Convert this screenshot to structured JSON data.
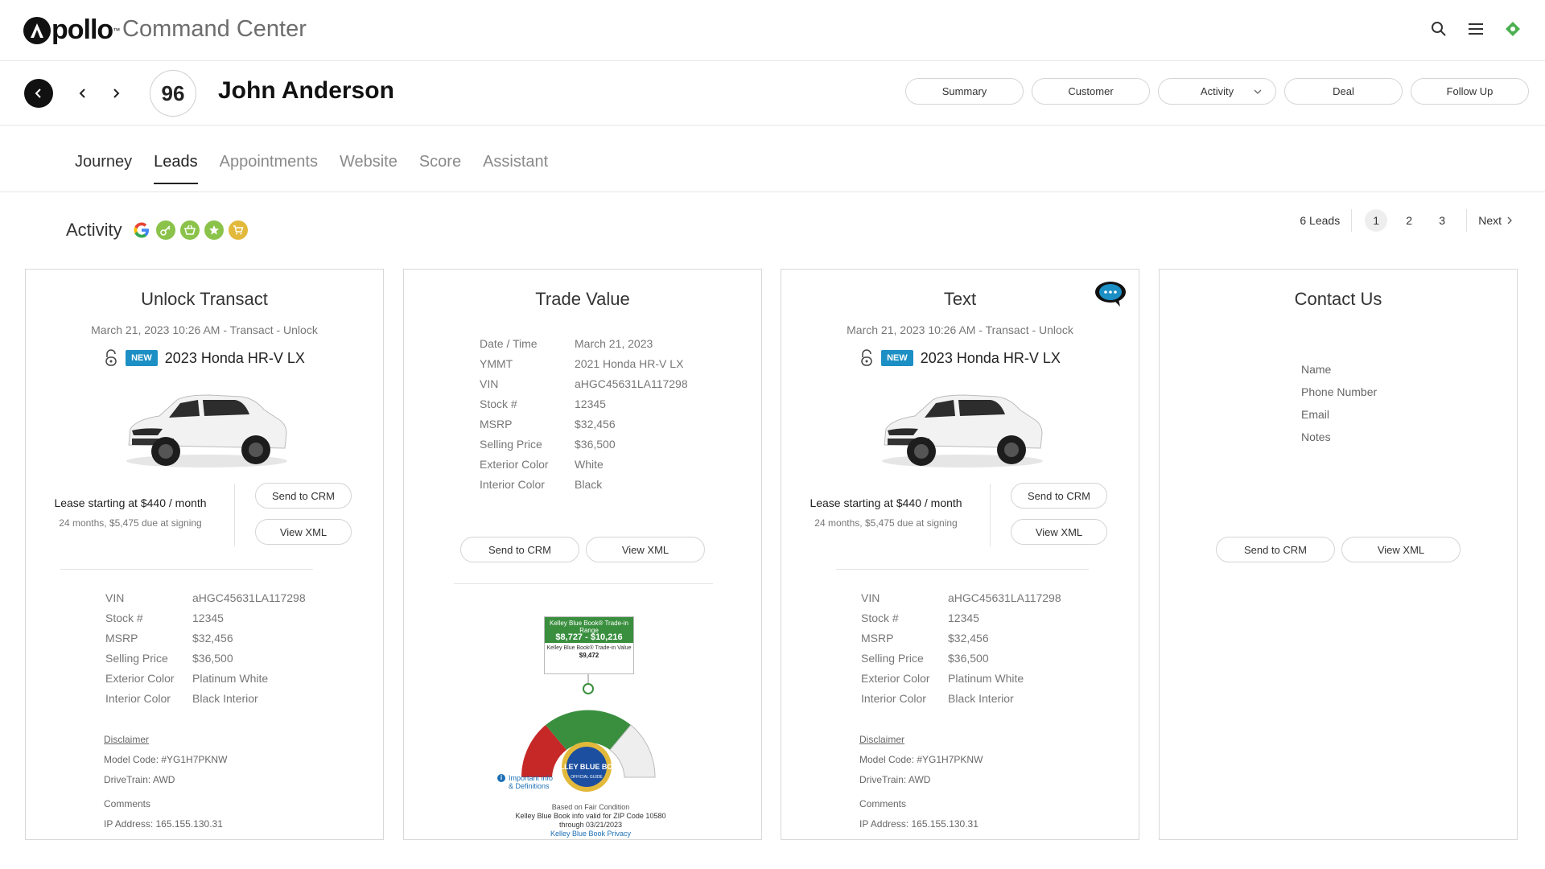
{
  "app": {
    "logo_text": "pollo",
    "logo_tm": "™",
    "title": "Command Center",
    "colors": {
      "accent_green": "#4caf50",
      "new_badge": "#1c8fc4",
      "kbb_green": "#3a8f3f",
      "kbb_red": "#c62828"
    }
  },
  "header": {
    "score": "96",
    "customer_name": "John Anderson",
    "pills": [
      {
        "label": "Summary"
      },
      {
        "label": "Customer"
      },
      {
        "label": "Activity"
      },
      {
        "label": "Deal"
      },
      {
        "label": "Follow Up"
      }
    ]
  },
  "tabs": [
    {
      "label": "Journey"
    },
    {
      "label": "Leads"
    },
    {
      "label": "Appointments"
    },
    {
      "label": "Website"
    },
    {
      "label": "Score"
    },
    {
      "label": "Assistant"
    }
  ],
  "activity": {
    "label": "Activity",
    "icons": [
      "google-icon",
      "key-icon",
      "basket-icon",
      "star-icon",
      "cart-icon"
    ]
  },
  "pager": {
    "count": "6 Leads",
    "pages": [
      "1",
      "2",
      "3"
    ],
    "next": "Next"
  },
  "cards": {
    "unlock": {
      "title": "Unlock Transact",
      "subtitle": "March 21, 2023 10:26 AM - Transact - Unlock",
      "badge": "NEW",
      "vehicle": "2023 Honda HR-V LX",
      "lease_main": "Lease starting at $440 / month",
      "lease_sub": "24 months, $5,475 due at signing",
      "send_label": "Send to CRM",
      "xml_label": "View XML",
      "specs": [
        {
          "k": "VIN",
          "v": "aHGC45631LA117298"
        },
        {
          "k": "Stock #",
          "v": "12345"
        },
        {
          "k": "MSRP",
          "v": "$32,456"
        },
        {
          "k": "Selling Price",
          "v": "$36,500"
        },
        {
          "k": "Exterior Color",
          "v": "Platinum White"
        },
        {
          "k": "Interior Color",
          "v": "Black Interior"
        }
      ],
      "disclaimer": "Disclaimer",
      "model_code": "Model Code: #YG1H7PKNW",
      "drivetrain": "DriveTrain: AWD",
      "comments": "Comments",
      "ip": "IP Address: 165.155.130.31"
    },
    "trade": {
      "title": "Trade Value",
      "specs": [
        {
          "k": "Date / Time",
          "v": "March 21, 2023"
        },
        {
          "k": "YMMT",
          "v": "2021 Honda HR-V LX"
        },
        {
          "k": "VIN",
          "v": "aHGC45631LA117298"
        },
        {
          "k": "Stock #",
          "v": "12345"
        },
        {
          "k": "MSRP",
          "v": "$32,456"
        },
        {
          "k": "Selling Price",
          "v": "$36,500"
        },
        {
          "k": "Exterior Color",
          "v": "White"
        },
        {
          "k": "Interior Color",
          "v": "Black"
        }
      ],
      "send_label": "Send to CRM",
      "xml_label": "View XML",
      "kbb": {
        "header": "Kelley Blue Book® Trade-in Range",
        "range": "$8,727 - $10,216",
        "value_label": "Kelley Blue Book® Trade-in Value",
        "value": "$9,472",
        "seal_text": "KELLEY BLUE BOOK",
        "seal_sub": "OFFICIAL GUIDE",
        "info": "Important info & Definitions",
        "condition": "Based on Fair Condition",
        "zip_note": "Kelley Blue Book info valid for ZIP Code 10580",
        "through": "through 03/21/2023",
        "privacy": "Kelley Blue Book Privacy"
      }
    },
    "text": {
      "title": "Text",
      "subtitle": "March 21, 2023 10:26 AM - Transact - Unlock",
      "badge": "NEW",
      "vehicle": "2023 Honda HR-V LX",
      "lease_main": "Lease starting at $440 / month",
      "lease_sub": "24 months, $5,475 due at signing",
      "send_label": "Send to CRM",
      "xml_label": "View XML",
      "specs": [
        {
          "k": "VIN",
          "v": "aHGC45631LA117298"
        },
        {
          "k": "Stock #",
          "v": "12345"
        },
        {
          "k": "MSRP",
          "v": "$32,456"
        },
        {
          "k": "Selling Price",
          "v": "$36,500"
        },
        {
          "k": "Exterior Color",
          "v": "Platinum White"
        },
        {
          "k": "Interior Color",
          "v": "Black Interior"
        }
      ],
      "disclaimer": "Disclaimer",
      "model_code": "Model Code: #YG1H7PKNW",
      "drivetrain": "DriveTrain: AWD",
      "comments": "Comments",
      "ip": "IP Address: 165.155.130.31"
    },
    "contact": {
      "title": "Contact Us",
      "fields": [
        "Name",
        "Phone Number",
        "Email",
        "Notes"
      ],
      "send_label": "Send to CRM",
      "xml_label": "View XML"
    }
  }
}
